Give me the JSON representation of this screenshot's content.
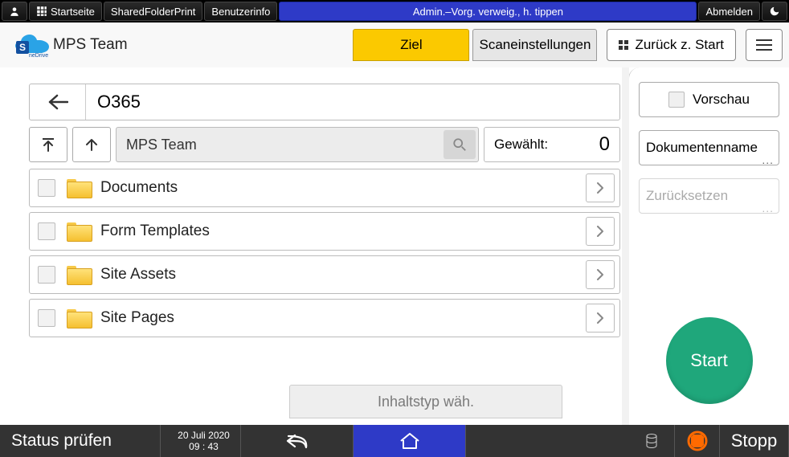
{
  "sysbar": {
    "startseite": "Startseite",
    "sharedfolder": "SharedFolderPrint",
    "benutzerinfo": "Benutzerinfo",
    "admin_msg": "Admin.–Vorg. verweig., h. tippen",
    "abmelden": "Abmelden"
  },
  "header": {
    "title": "MPS Team",
    "tab_ziel": "Ziel",
    "tab_scan": "Scaneinstellungen",
    "back_start": "Zurück z. Start"
  },
  "main": {
    "back_label": "O365",
    "search_value": "MPS Team",
    "count_label": "Gewählt:",
    "count_value": "0",
    "folders": [
      {
        "name": "Documents"
      },
      {
        "name": "Form Templates"
      },
      {
        "name": "Site Assets"
      },
      {
        "name": "Site Pages"
      }
    ],
    "content_type": "Inhaltstyp wäh."
  },
  "side": {
    "vorschau": "Vorschau",
    "dokname": "Dokumentenname",
    "reset": "Zurücksetzen",
    "start": "Start"
  },
  "footer": {
    "status": "Status prüfen",
    "date": "20 Juli 2020",
    "time": "09 : 43",
    "stopp": "Stopp"
  }
}
